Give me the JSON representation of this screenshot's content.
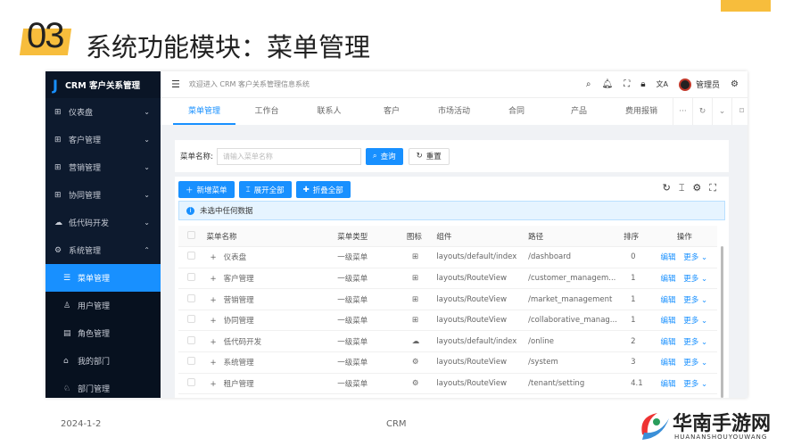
{
  "slide": {
    "number": "03",
    "title": "系统功能模块：菜单管理",
    "date": "2024-1-2",
    "footer_center": "CRM",
    "watermark": "华南手游网",
    "watermark_sub": "HUANANSHOUYOUWANG"
  },
  "app": {
    "logo": "CRM 客户关系管理",
    "welcome": "欢迎进入 CRM 客户关系管理信息系统",
    "user": "管理员",
    "sidebar": [
      {
        "label": "仪表盘",
        "icon": "grid-icon",
        "chev": "⌄"
      },
      {
        "label": "客户管理",
        "icon": "grid-icon",
        "chev": "⌄"
      },
      {
        "label": "营销管理",
        "icon": "grid-icon",
        "chev": "⌄"
      },
      {
        "label": "协同管理",
        "icon": "grid-icon",
        "chev": "⌄"
      },
      {
        "label": "低代码开发",
        "icon": "cloud-icon",
        "chev": "⌄"
      },
      {
        "label": "系统管理",
        "icon": "gear-icon",
        "chev": "⌃"
      }
    ],
    "subitems": [
      {
        "label": "菜单管理",
        "active": true
      },
      {
        "label": "用户管理"
      },
      {
        "label": "角色管理"
      },
      {
        "label": "我的部门"
      },
      {
        "label": "部门管理"
      }
    ],
    "tabs": [
      "菜单管理",
      "工作台",
      "联系人",
      "客户",
      "市场活动",
      "合同",
      "产品",
      "费用报销"
    ],
    "search": {
      "label": "菜单名称:",
      "placeholder": "请输入菜单名称",
      "query": "查询",
      "reset": "重置"
    },
    "toolbar": {
      "add": "新增菜单",
      "expand": "展开全部",
      "collapse": "折叠全部"
    },
    "alert": "未选中任何数据",
    "columns": [
      "菜单名称",
      "菜单类型",
      "图标",
      "组件",
      "路径",
      "排序",
      "操作"
    ],
    "rows": [
      {
        "name": "仪表盘",
        "type": "一级菜单",
        "icon": "⊞",
        "component": "layouts/default/index",
        "path": "/dashboard",
        "order": "0"
      },
      {
        "name": "客户管理",
        "type": "一级菜单",
        "icon": "⊞",
        "component": "layouts/RouteView",
        "path": "/customer_managem...",
        "order": "1"
      },
      {
        "name": "营销管理",
        "type": "一级菜单",
        "icon": "⊞",
        "component": "layouts/RouteView",
        "path": "/market_management",
        "order": "1"
      },
      {
        "name": "协同管理",
        "type": "一级菜单",
        "icon": "⊞",
        "component": "layouts/RouteView",
        "path": "/collaborative_manag...",
        "order": "1"
      },
      {
        "name": "低代码开发",
        "type": "一级菜单",
        "icon": "☁",
        "component": "layouts/default/index",
        "path": "/online",
        "order": "2"
      },
      {
        "name": "系统管理",
        "type": "一级菜单",
        "icon": "⚙",
        "component": "layouts/RouteView",
        "path": "/system",
        "order": "3"
      },
      {
        "name": "租户管理",
        "type": "一级菜单",
        "icon": "⚙",
        "component": "layouts/RouteView",
        "path": "/tenant/setting",
        "order": "4.1"
      }
    ],
    "edit": "编辑",
    "more": "更多"
  }
}
